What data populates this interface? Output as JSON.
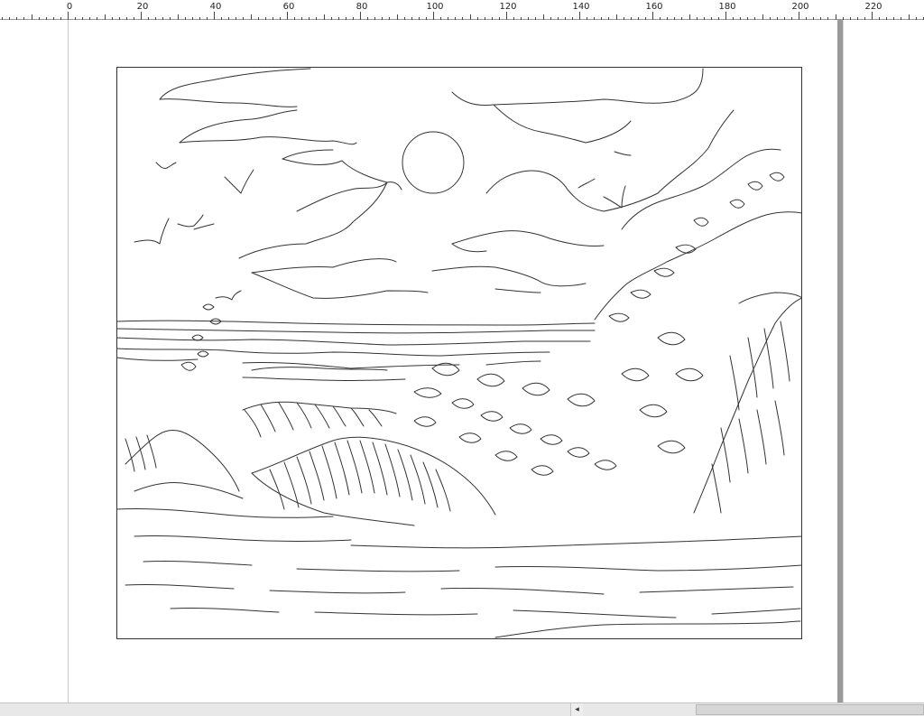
{
  "ruler": {
    "unit_labels": [
      "0",
      "20",
      "40",
      "60",
      "80",
      "100",
      "120",
      "140",
      "160",
      "180",
      "200",
      "220"
    ]
  },
  "document": {
    "content": "line-art coloring page: ocean waves crashing on rocks, sun, clouds, seagulls"
  },
  "colors": {
    "line": "#333333",
    "page_shadow": "#9b9b9b",
    "scrollbar": "#e8e8e8"
  },
  "scrollbar": {
    "left_arrow_icon": "◂"
  }
}
